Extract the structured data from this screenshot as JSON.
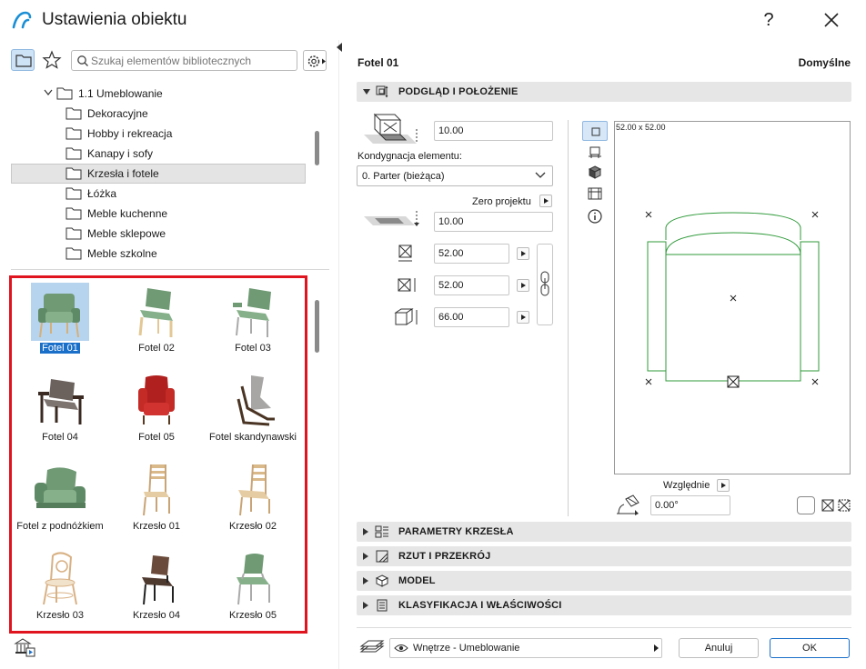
{
  "window": {
    "title": "Ustawienia obiektu",
    "help": "?"
  },
  "search": {
    "placeholder": "Szukaj elementów bibliotecznych"
  },
  "tree": {
    "items": [
      {
        "label": "1.1 Umeblowanie",
        "expanded": true
      },
      {
        "label": "Dekoracyjne"
      },
      {
        "label": "Hobby i rekreacja"
      },
      {
        "label": "Kanapy i sofy"
      },
      {
        "label": "Krzesła i fotele",
        "selected": true
      },
      {
        "label": "Łóżka"
      },
      {
        "label": "Meble kuchenne"
      },
      {
        "label": "Meble sklepowe"
      },
      {
        "label": "Meble szkolne"
      }
    ]
  },
  "grid": {
    "items": [
      {
        "label": "Fotel 01",
        "selected": true,
        "icon": "armchair-green"
      },
      {
        "label": "Fotel 02",
        "icon": "armchair-green-wood"
      },
      {
        "label": "Fotel 03",
        "icon": "armchair-green-metal"
      },
      {
        "label": "Fotel 04",
        "icon": "armchair-dark"
      },
      {
        "label": "Fotel 05",
        "icon": "wingchair-red"
      },
      {
        "label": "Fotel skandynawski",
        "icon": "lounge-chair-grey"
      },
      {
        "label": "Fotel z podnóżkiem",
        "icon": "armchair-ottoman-green"
      },
      {
        "label": "Krzesło 01",
        "icon": "chair-wood"
      },
      {
        "label": "Krzesło 02",
        "icon": "chair-wood"
      },
      {
        "label": "Krzesło 03",
        "icon": "bentwood-chair"
      },
      {
        "label": "Krzesło 04",
        "icon": "chair-dark"
      },
      {
        "label": "Krzesło 05",
        "icon": "chair-green-metal"
      }
    ]
  },
  "right": {
    "object_name": "Fotel 01",
    "default_label": "Domyślne",
    "sections": {
      "preview": "PODGLĄD I POŁOŻENIE",
      "params": "PARAMETRY KRZESŁA",
      "plan": "RZUT I PRZEKRÓJ",
      "model": "MODEL",
      "classification": "KLASYFIKACJA I WŁAŚCIWOŚCI"
    },
    "elevation_value": "10.00",
    "storey_label": "Kondygnacja elementu:",
    "storey_value": "0. Parter (bieżąca)",
    "zero_label": "Zero projektu",
    "zero_value": "10.00",
    "dim_x": "52.00",
    "dim_y": "52.00",
    "dim_z": "66.00",
    "preview_size": "52.00 x 52.00",
    "relative_label": "Względnie",
    "angle_value": "0.00°"
  },
  "footer": {
    "layer_value": "Wnętrze - Umeblowanie",
    "cancel": "Anuluj",
    "ok": "OK"
  },
  "colors": {
    "accent": "#1a6fc9",
    "highlight_border": "#e0141e",
    "plan_line": "#2f9a3a"
  }
}
